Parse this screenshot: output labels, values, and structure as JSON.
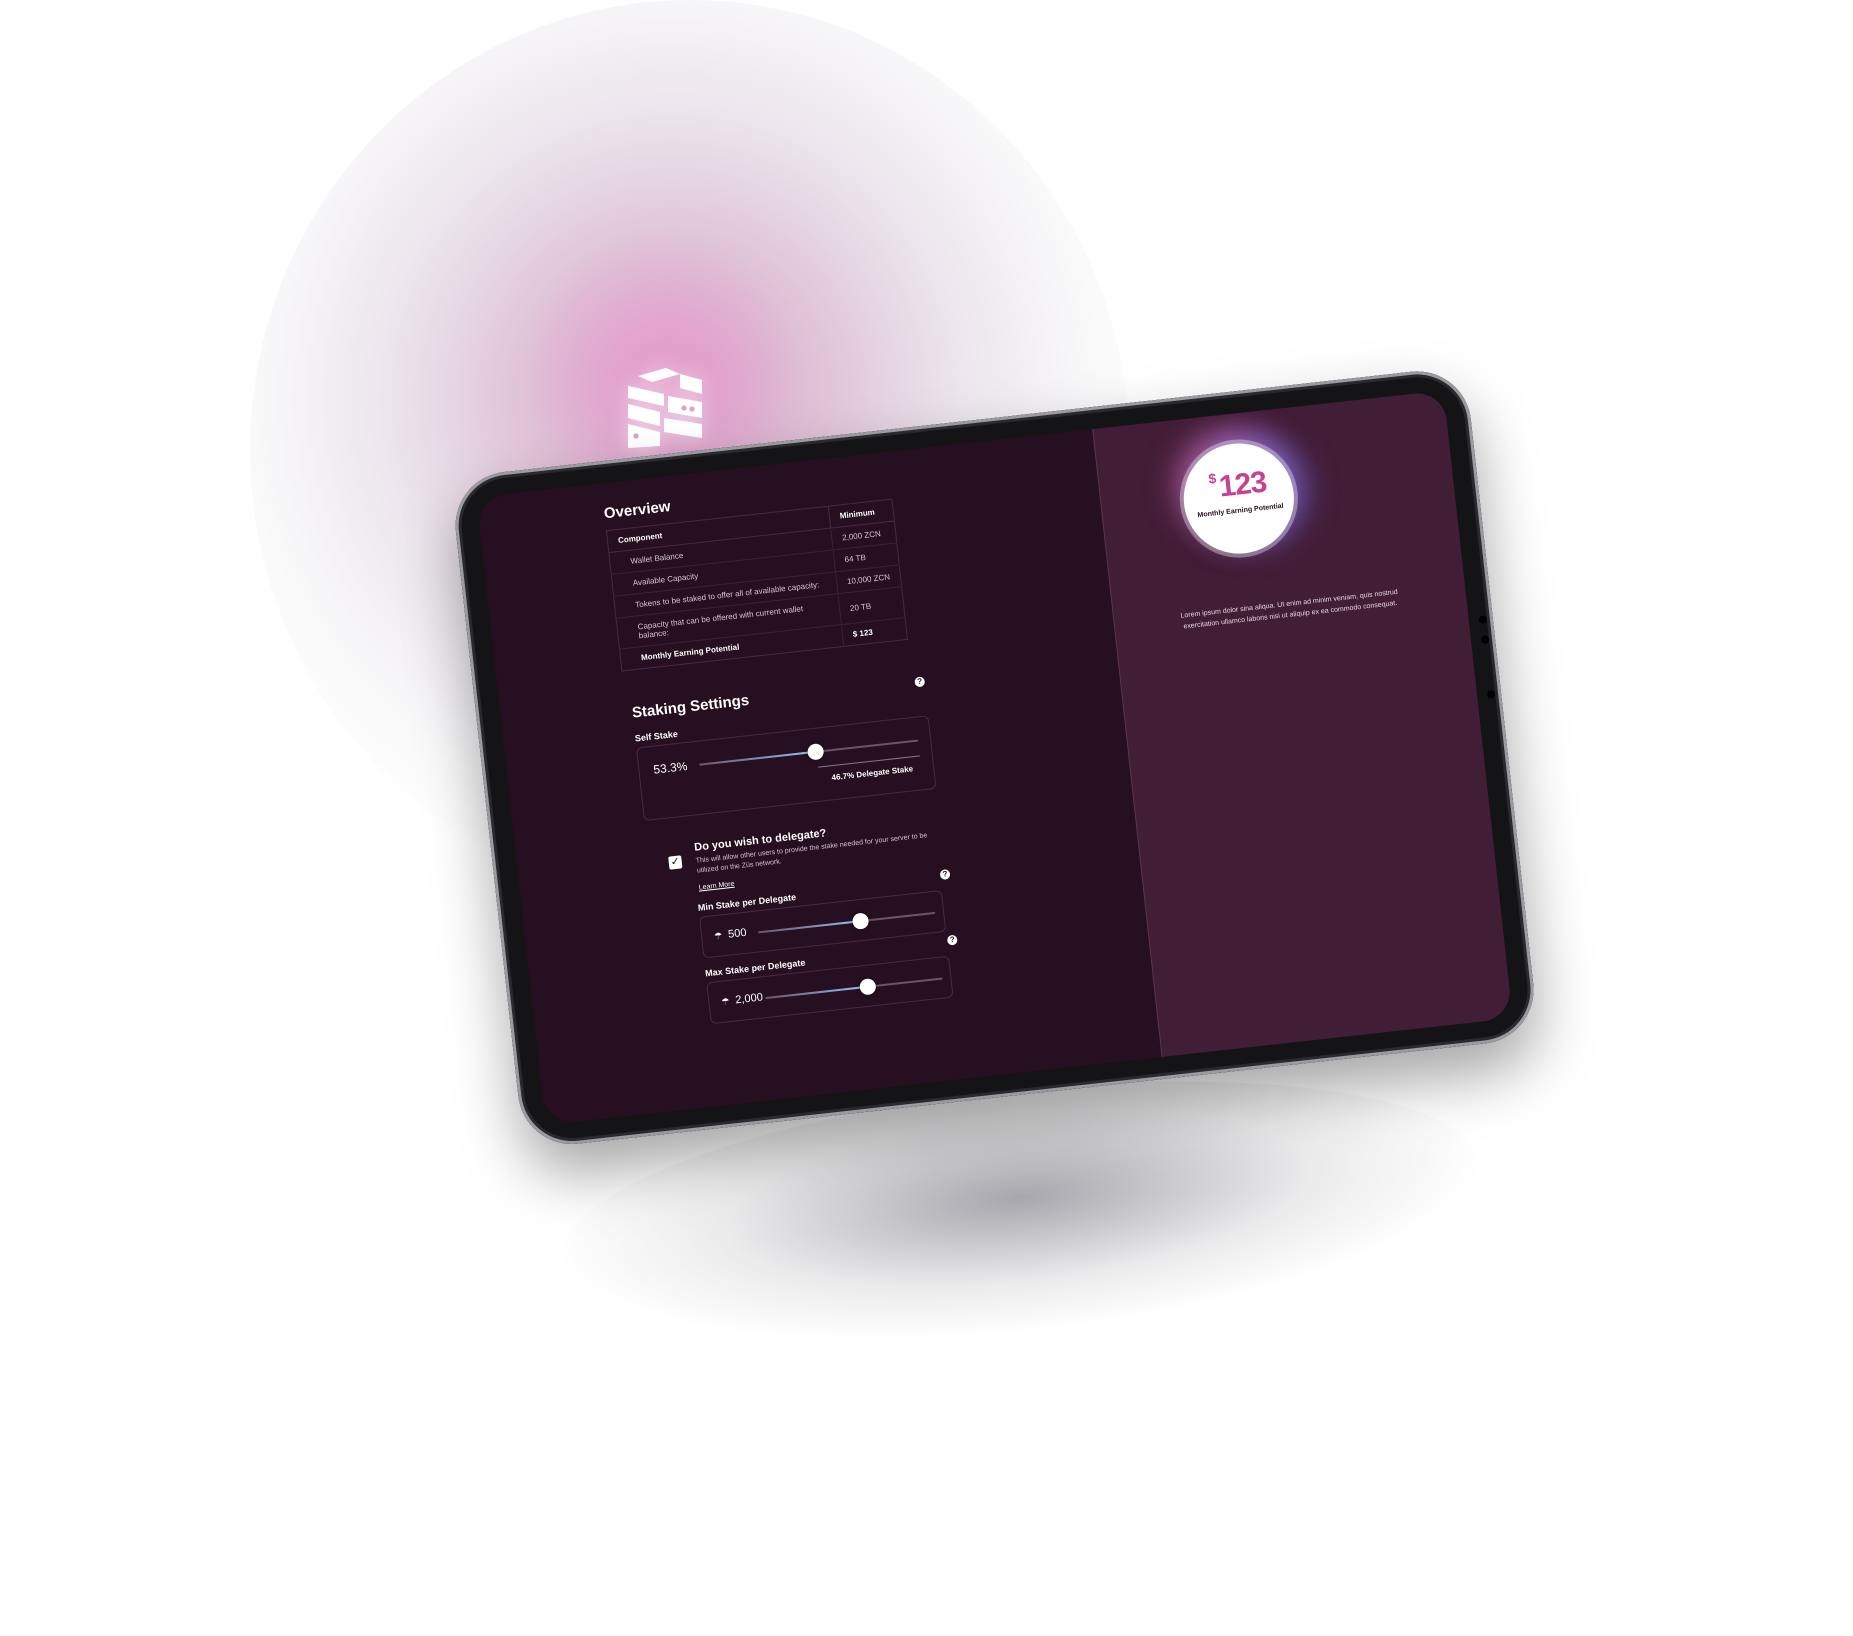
{
  "overview": {
    "title": "Overview",
    "table": {
      "headers": [
        "Component",
        "Minimum"
      ],
      "rows": [
        {
          "label": "Wallet Balance",
          "value": "2,000 ZCN"
        },
        {
          "label": "Available Capacity",
          "value": "64 TB"
        },
        {
          "label": "Tokens to be staked to offer all of available capacity:",
          "value": "10,000 ZCN"
        },
        {
          "label": "Capacity that can be offered with current wallet balance:",
          "value": "20 TB"
        }
      ],
      "total": {
        "label": "Monthly Earning Potential",
        "value": "$ 123"
      }
    }
  },
  "staking": {
    "title": "Staking Settings",
    "help": "?",
    "self_stake": {
      "label": "Self Stake",
      "value_text": "53.3%",
      "fraction": 0.533,
      "delegate_text": "46.7% Delegate Stake"
    },
    "delegate": {
      "title": "Do you wish to delegate?",
      "description": "This will allow other users to provide the stake needed for your server to be utilized on the Züs network.",
      "learn_more": "Learn More",
      "checked": true,
      "check_glyph": "✓"
    },
    "min_stake": {
      "label": "Min Stake per Delegate",
      "value": "500",
      "fraction": 0.58,
      "icon": "coin-icon"
    },
    "max_stake": {
      "label": "Max Stake per Delegate",
      "value": "2,000",
      "fraction": 0.58,
      "icon": "coin-icon"
    }
  },
  "earnings": {
    "currency": "$",
    "amount": "123",
    "label": "Monthly Earning Potential",
    "description": "Lorem ipsum dolor sina aliqua. Ut enim ad minim veniam, quis nostrud exercitation ullamco laboris nisi ut aliquip ex ea commodo consequat."
  },
  "colors": {
    "panel_dark": "#260f20",
    "panel_right": "#421d36",
    "accent": "#c6418f",
    "slider_fill": "#8ec2ff"
  },
  "icons": {
    "logo": "zus-logo-icon",
    "help": "question-icon",
    "checkbox": "check-icon",
    "coin": "coin-icon"
  }
}
